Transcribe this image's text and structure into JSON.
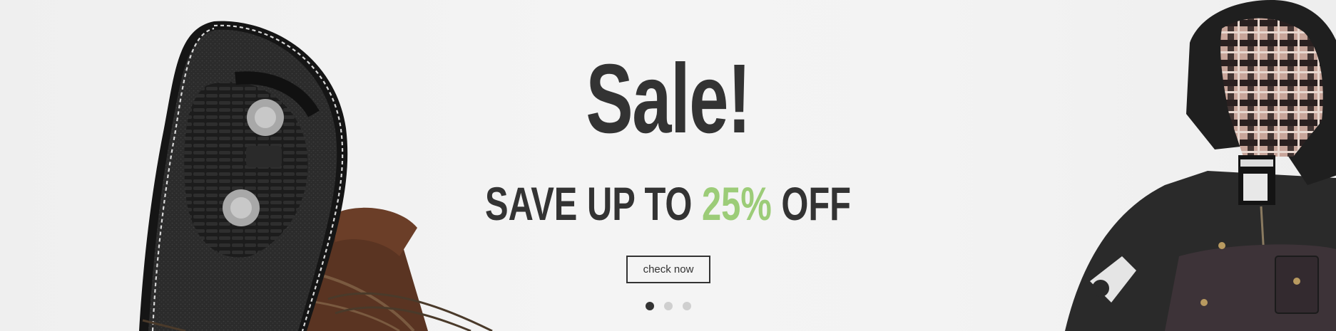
{
  "slide": {
    "headline": "Sale!",
    "subheadline_prefix": "SAVE UP TO ",
    "subheadline_accent": "25%",
    "subheadline_suffix": " OFF",
    "cta_label": "check now",
    "accent_color": "#9ccc78",
    "text_color": "#333333",
    "left_image": "boot-sole-image",
    "right_image": "jacket-image"
  },
  "carousel": {
    "dot_count": 3,
    "active_index": 0
  }
}
